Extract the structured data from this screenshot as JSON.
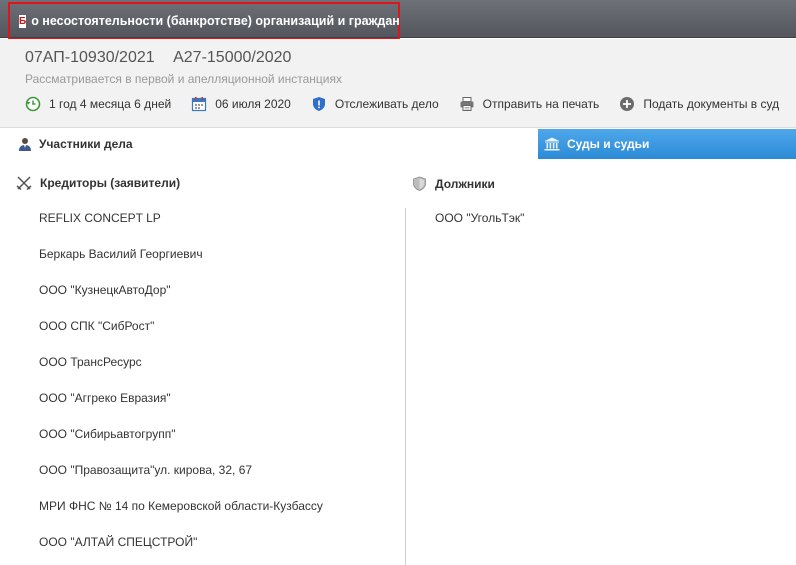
{
  "header": {
    "badge": "Б",
    "case_type": "о несостоятельности (банкротстве) организаций и граждан"
  },
  "case": {
    "number_appeal": "07АП-10930/2021",
    "number_first": "А27-15000/2020",
    "status": "Рассматривается в первой и апелляционной инстанциях"
  },
  "toolbar": {
    "duration": "1 год 4 месяца 6 дней",
    "date": "06 июля 2020",
    "track": "Отслеживать дело",
    "print": "Отправить на печать",
    "submit": "Подать документы в суд"
  },
  "tabs": {
    "participants": "Участники дела",
    "courts": "Суды и судьи"
  },
  "creditors": {
    "heading": "Кредиторы (заявители)",
    "items": [
      "REFLIX CONCEPT LP",
      "Беркарь Василий Георгиевич",
      "ООО \"КузнецкАвтоДор\"",
      "ООО СПК \"СибРост\"",
      "ООО ТрансРесурс",
      "ООО \"Аггреко Евразия\"",
      "ООО \"Сибирьавтогрупп\"",
      "ООО \"Правозащита\"ул. кирова, 32, 67",
      "МРИ ФНС № 14 по Кемеровской области-Кузбассу",
      "ООО \"АЛТАЙ СПЕЦСТРОЙ\""
    ]
  },
  "debtors": {
    "heading": "Должники",
    "items": [
      "ООО \"УгольТэк\""
    ]
  },
  "colors": {
    "header_bg": "#5f6268",
    "highlight_border": "#e0141b",
    "tab_active": "#3a98de"
  }
}
